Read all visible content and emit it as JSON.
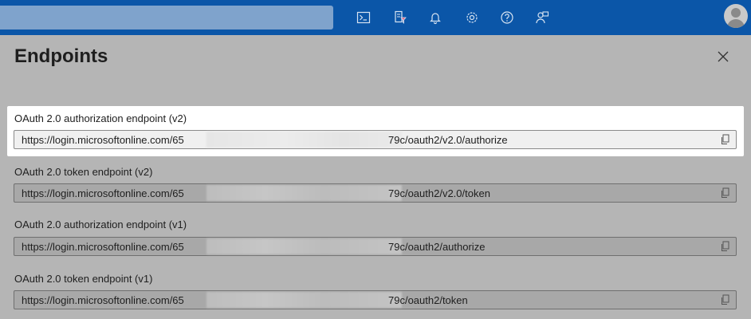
{
  "topbar": {
    "icons": [
      "cloud-shell-icon",
      "directory-filter-icon",
      "notifications-icon",
      "settings-icon",
      "help-icon",
      "feedback-icon"
    ]
  },
  "panel": {
    "title": "Endpoints"
  },
  "endpoints": [
    {
      "label": "OAuth 2.0 authorization endpoint (v2)",
      "prefix": "https://login.microsoftonline.com/65",
      "suffix": "79c/oauth2/v2.0/authorize"
    },
    {
      "label": "OAuth 2.0 token endpoint (v2)",
      "prefix": "https://login.microsoftonline.com/65",
      "suffix": "79c/oauth2/v2.0/token"
    },
    {
      "label": "OAuth 2.0 authorization endpoint (v1)",
      "prefix": "https://login.microsoftonline.com/65",
      "suffix": "79c/oauth2/authorize"
    },
    {
      "label": "OAuth 2.0 token endpoint (v1)",
      "prefix": "https://login.microsoftonline.com/65",
      "suffix": "79c/oauth2/token"
    }
  ]
}
